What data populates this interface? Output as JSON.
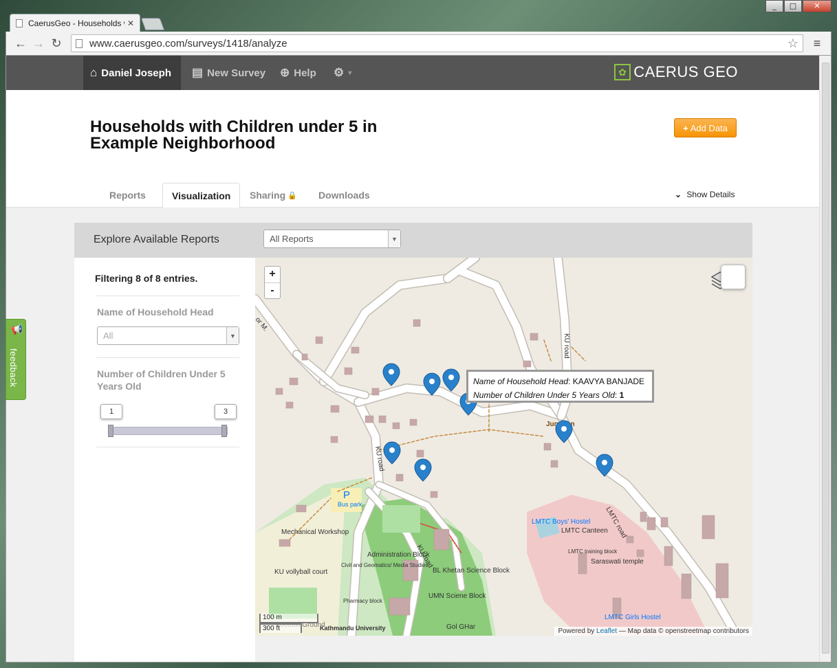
{
  "browser": {
    "tab_title": "CaerusGeo - Households w",
    "url": "www.caerusgeo.com/surveys/1418/analyze",
    "window_buttons": [
      "_",
      "□",
      "✕"
    ],
    "nav_icons": [
      "back-icon",
      "forward-icon",
      "reload-icon",
      "star-icon",
      "menu-icon"
    ]
  },
  "navbar": {
    "user": "Daniel Joseph",
    "new_survey": "New Survey",
    "help": "Help",
    "settings_caret": "▾",
    "brand": "CAERUS GEO",
    "bg_color": "#555555",
    "brand_color": "#8cc63f"
  },
  "page": {
    "title": "Households with Children under 5 in Example Neighborhood",
    "add_data": "Add Data",
    "add_data_color": "#f89406"
  },
  "tabs": [
    {
      "label": "Reports",
      "active": false
    },
    {
      "label": "Visualization",
      "active": true
    },
    {
      "label": "Sharing",
      "active": false,
      "locked": true
    },
    {
      "label": "Downloads",
      "active": false
    }
  ],
  "show_details": "Show Details",
  "explore": {
    "label": "Explore Available Reports",
    "select_value": "All Reports"
  },
  "filters": {
    "count_text": "Filtering 8 of 8 entries.",
    "household_head_label": "Name of Household Head",
    "household_head_value": "All",
    "children_label": "Number of Children Under 5 Years Old",
    "slider_min": "1",
    "slider_max": "3"
  },
  "map": {
    "zoom_in": "+",
    "zoom_out": "-",
    "popup": {
      "field1_label": "Name of Household Head",
      "field1_value": "KAAVYA BANJADE",
      "field2_label": "Number of Children Under 5 Years Old",
      "field2_value": "1"
    },
    "scale_metric": "100 m",
    "scale_imperial": "300 ft",
    "attribution_prefix": "Powered by",
    "attribution_link": "Leaflet",
    "attribution_suffix": "— Map data © openstreetmap contributors",
    "marker_color": "#2a81cb",
    "labels": [
      "KU road",
      "KU road",
      "LMTC road",
      "KU road",
      "Bus park",
      "Mechanical Workshop",
      "KU vollyball court",
      "Civil and Geomatics/ Media Studies",
      "Pharmacy block",
      "Administration Block",
      "BL Khetan Science Block",
      "UMN Sciene Block",
      "Gol GHar",
      "LMTC Boys' Hostel",
      "LMTC Canteen",
      "LMTC training block",
      "Saraswati temple",
      "LMTC Girls Hostel",
      "Kathmandu University",
      "Junction",
      "or M.",
      "Football Ground",
      "P"
    ]
  },
  "feedback": "feedback"
}
